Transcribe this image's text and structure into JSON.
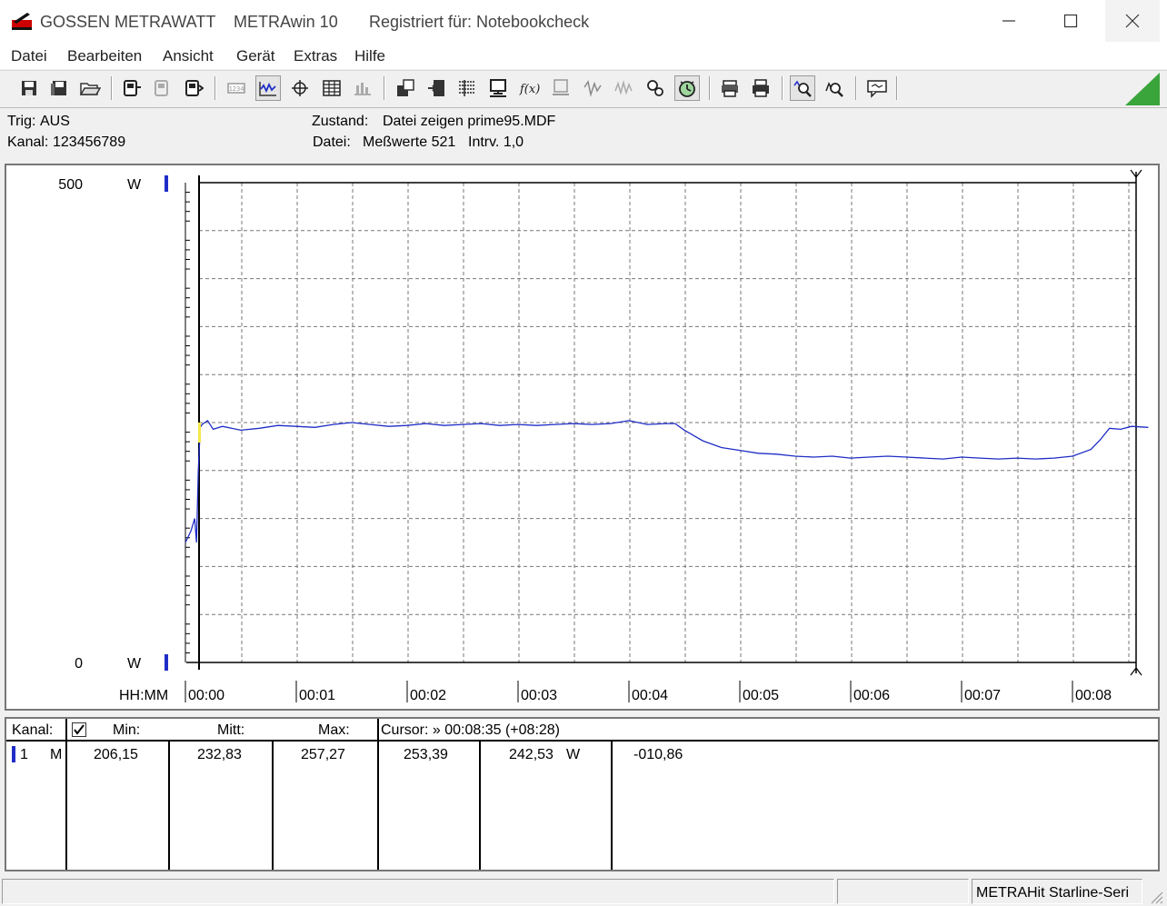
{
  "window": {
    "brand": "GOSSEN METRAWATT",
    "app_name": "METRAwin 10",
    "registration": "Registriert für: Notebookcheck",
    "controls": [
      "minimize-icon",
      "maximize-icon",
      "close-icon"
    ]
  },
  "menu": [
    "Datei",
    "Bearbeiten",
    "Ansicht",
    "Gerät",
    "Extras",
    "Hilfe"
  ],
  "toolbar": {
    "icons": [
      "save-icon",
      "save-all-icon",
      "open-folder-icon",
      "device-read-icon",
      "device-disabled-icon",
      "device-write-icon",
      "counter-icon",
      "waveform-view-icon",
      "crosshair-icon",
      "table-view-icon",
      "bars-view-icon",
      "export-icon",
      "import-icon",
      "config-icon",
      "computer-icon",
      "formula-icon",
      "memory-icon",
      "signal-icon",
      "signal-disabled-icon",
      "settings-icon",
      "timer-icon",
      "print-preview-icon",
      "print-icon",
      "zoom-in-icon",
      "zoom-out-icon",
      "message-icon"
    ],
    "pressed": [
      "waveform-view-icon",
      "timer-icon",
      "zoom-in-icon"
    ],
    "status_triangle_color": "#3aa53a"
  },
  "info": {
    "trig_label": "Trig:",
    "trig_value": "AUS",
    "kanal_label": "Kanal:",
    "kanal_value": "123456789",
    "zustand_label": "Zustand:",
    "zustand_value": "Datei zeigen prime95.MDF",
    "datei_label": "Datei:",
    "datei_value": "Meßwerte 521",
    "interval": "Intrv. 1,0"
  },
  "chart_data": {
    "type": "line",
    "y_top_label": "500",
    "y_bottom_label": "0",
    "y_unit": "W",
    "ylim": [
      0,
      500
    ],
    "xlim_seconds": [
      0,
      521
    ],
    "x_axis_label": "HH:MM",
    "x_ticks": [
      "00:00",
      "00:01",
      "00:02",
      "00:03",
      "00:04",
      "00:05",
      "00:06",
      "00:07",
      "00:08"
    ],
    "grid": true,
    "line_color": "#1f2dc6",
    "series": [
      {
        "points": [
          [
            0,
            125
          ],
          [
            3,
            137
          ],
          [
            5,
            150
          ],
          [
            6,
            125
          ],
          [
            7,
            200
          ],
          [
            8,
            245
          ],
          [
            9,
            248
          ],
          [
            12,
            252
          ],
          [
            15,
            243
          ],
          [
            20,
            246
          ],
          [
            30,
            242
          ],
          [
            40,
            244
          ],
          [
            50,
            247
          ],
          [
            60,
            246
          ],
          [
            70,
            245
          ],
          [
            80,
            248
          ],
          [
            90,
            250
          ],
          [
            100,
            248
          ],
          [
            110,
            246
          ],
          [
            120,
            247
          ],
          [
            130,
            249
          ],
          [
            140,
            247
          ],
          [
            150,
            248
          ],
          [
            160,
            249
          ],
          [
            170,
            247
          ],
          [
            180,
            248
          ],
          [
            190,
            247
          ],
          [
            200,
            248
          ],
          [
            210,
            249
          ],
          [
            220,
            248
          ],
          [
            230,
            249
          ],
          [
            240,
            252
          ],
          [
            250,
            248
          ],
          [
            260,
            249
          ],
          [
            265,
            249
          ],
          [
            270,
            242
          ],
          [
            280,
            231
          ],
          [
            290,
            224
          ],
          [
            300,
            221
          ],
          [
            310,
            218
          ],
          [
            320,
            217
          ],
          [
            330,
            215
          ],
          [
            340,
            214
          ],
          [
            350,
            215
          ],
          [
            360,
            213
          ],
          [
            370,
            214
          ],
          [
            380,
            215
          ],
          [
            390,
            214
          ],
          [
            400,
            213
          ],
          [
            410,
            212
          ],
          [
            420,
            214
          ],
          [
            430,
            213
          ],
          [
            440,
            212
          ],
          [
            450,
            213
          ],
          [
            460,
            212
          ],
          [
            470,
            213
          ],
          [
            480,
            215
          ],
          [
            490,
            222
          ],
          [
            495,
            232
          ],
          [
            500,
            244
          ],
          [
            506,
            243
          ],
          [
            512,
            246
          ],
          [
            521,
            245
          ]
        ]
      }
    ]
  },
  "table": {
    "headers": {
      "kanal": "Kanal:",
      "min": "Min:",
      "mitt": "Mitt:",
      "max": "Max:",
      "cursor": "Cursor: » 00:08:35 (+08:28)"
    },
    "header_checked": true,
    "row": {
      "kanal": "1",
      "mode": "M",
      "min": "206,15",
      "mitt": "232,83",
      "max": "257,27",
      "cursor_value": "253,39",
      "value2": "242,53",
      "unit": "W",
      "diff": "-010,86"
    }
  },
  "statusbar": {
    "right_text": "METRAHit Starline-Seri"
  }
}
